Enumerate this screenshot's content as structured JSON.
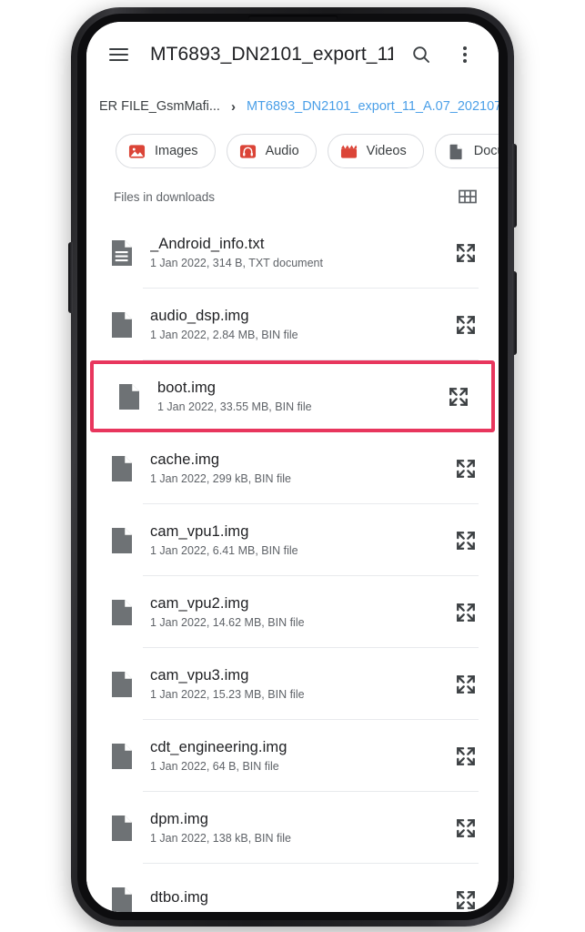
{
  "appbar": {
    "menu_icon": "hamburger-menu-icon",
    "title": "MT6893_DN2101_export_11...",
    "search_icon": "search-icon",
    "overflow_icon": "more-vert-icon"
  },
  "breadcrumb": {
    "previous": "ER FILE_GsmMafi...",
    "separator": "›",
    "current": "MT6893_DN2101_export_11_A.07_202107..."
  },
  "chips": [
    {
      "label": "Images",
      "icon": "image-icon",
      "color": "#DB4437"
    },
    {
      "label": "Audio",
      "icon": "headphone-icon",
      "color": "#DB4437"
    },
    {
      "label": "Videos",
      "icon": "clapboard-icon",
      "color": "#DB4437"
    },
    {
      "label": "Documents",
      "icon": "document-icon",
      "color": "#5F6368"
    }
  ],
  "section": {
    "title": "Files in downloads",
    "grid_icon": "grid-view-icon"
  },
  "files": [
    {
      "name": "_Android_info.txt",
      "meta": "1 Jan 2022, 314 B, TXT document",
      "icon": "text-document-icon",
      "highlighted": false
    },
    {
      "name": "audio_dsp.img",
      "meta": "1 Jan 2022, 2.84 MB, BIN file",
      "icon": "blank-document-icon",
      "highlighted": false
    },
    {
      "name": "boot.img",
      "meta": "1 Jan 2022, 33.55 MB, BIN file",
      "icon": "blank-document-icon",
      "highlighted": true
    },
    {
      "name": "cache.img",
      "meta": "1 Jan 2022, 299 kB, BIN file",
      "icon": "blank-document-icon",
      "highlighted": false
    },
    {
      "name": "cam_vpu1.img",
      "meta": "1 Jan 2022, 6.41 MB, BIN file",
      "icon": "blank-document-icon",
      "highlighted": false
    },
    {
      "name": "cam_vpu2.img",
      "meta": "1 Jan 2022, 14.62 MB, BIN file",
      "icon": "blank-document-icon",
      "highlighted": false
    },
    {
      "name": "cam_vpu3.img",
      "meta": "1 Jan 2022, 15.23 MB, BIN file",
      "icon": "blank-document-icon",
      "highlighted": false
    },
    {
      "name": "cdt_engineering.img",
      "meta": "1 Jan 2022, 64 B, BIN file",
      "icon": "blank-document-icon",
      "highlighted": false
    },
    {
      "name": "dpm.img",
      "meta": "1 Jan 2022, 138 kB, BIN file",
      "icon": "blank-document-icon",
      "highlighted": false
    },
    {
      "name": "dtbo.img",
      "meta": "",
      "icon": "blank-document-icon",
      "highlighted": false
    }
  ],
  "row_expand_icon": "expand-arrows-icon",
  "colors": {
    "highlight_border": "#E8365D",
    "link": "#4A9FE8",
    "chip_accent": "#DB4437",
    "text_primary": "#202124",
    "text_secondary": "#5F6368"
  }
}
